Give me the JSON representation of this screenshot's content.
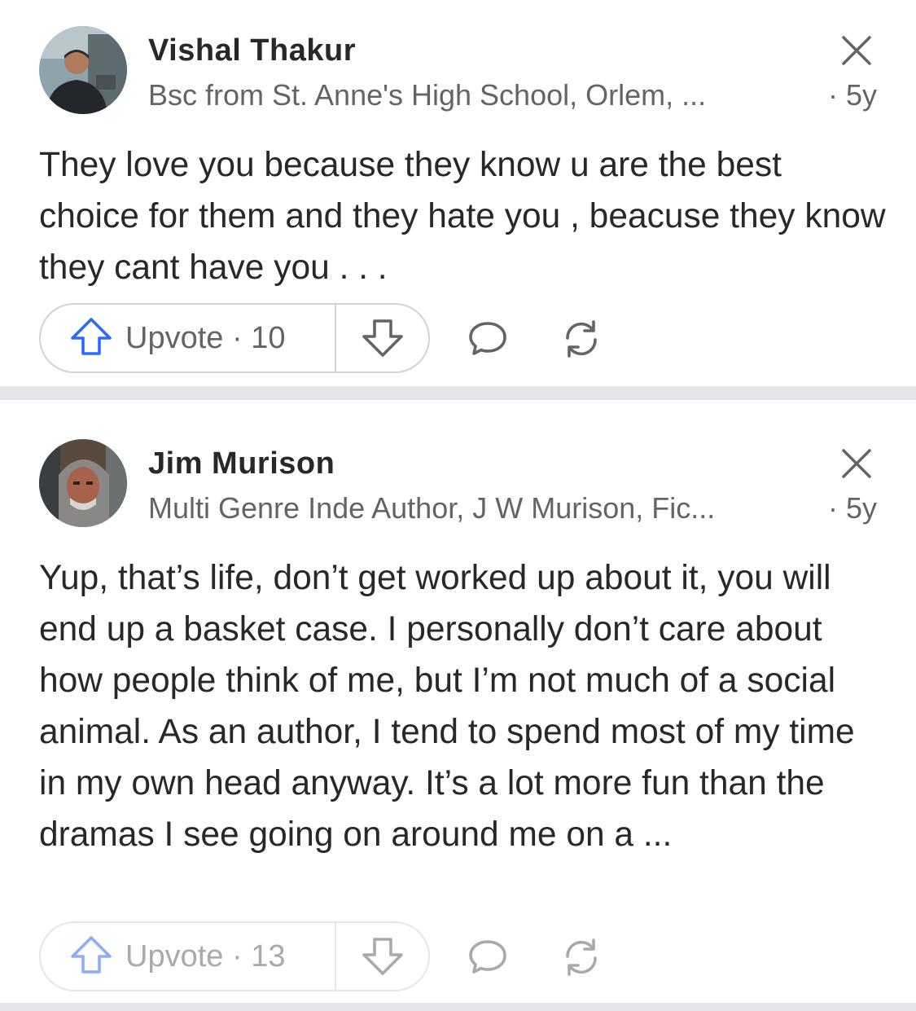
{
  "answers": [
    {
      "author": "Vishal Thakur",
      "credential": "Bsc from St. Anne's High School, Orlem, ...",
      "age": "5y",
      "dot": "·",
      "body": "They love you because they know u are the best choice for them and they hate you , beacuse they know they cant have you . . .",
      "upvote_label": "Upvote",
      "upvote_count": "10"
    },
    {
      "author": "Jim Murison",
      "credential": "Multi Genre Inde Author, J W Murison, Fic...",
      "age": "5y",
      "dot": "·",
      "body": "Yup, that’s life, don’t get worked up about it, you will end up a basket case. I personally don’t care about how people think of me, but I’m not much of a social animal. As an author, I tend to spend most of my time in my own head anyway. It’s a lot more fun than the dramas I see going on around me on a ...",
      "upvote_label": "Upvote",
      "upvote_count": "13"
    }
  ],
  "colors": {
    "text_primary": "#282829",
    "text_secondary": "#636466",
    "upvote_blue": "#2e69ff",
    "divider": "#e4e6e9"
  },
  "icons": {
    "upvote": "arrow-up-outline-icon",
    "downvote": "arrow-down-outline-icon",
    "comment": "speech-bubble-icon",
    "share": "circular-arrows-icon",
    "close": "x-close-icon"
  }
}
